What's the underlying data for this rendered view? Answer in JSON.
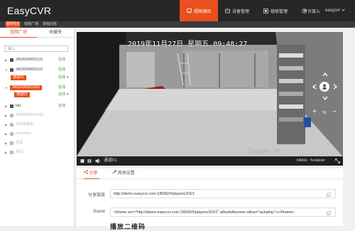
{
  "app": {
    "logo": "EasyCVR"
  },
  "nav": {
    "items": [
      {
        "label": "视频调阅",
        "icon": "monitor-icon",
        "active": true
      },
      {
        "label": "设备管理",
        "icon": "device-icon",
        "active": false
      },
      {
        "label": "级联管理",
        "icon": "cascade-icon",
        "active": false
      },
      {
        "label": "平台接入",
        "icon": "platform-icon",
        "active": false
      }
    ],
    "user": "easycvr"
  },
  "subnav": {
    "tabs": [
      {
        "label": "视频预览",
        "active": true
      },
      {
        "label": "视频广场",
        "active": false
      },
      {
        "label": "录像回看",
        "active": false
      }
    ]
  },
  "sidebar": {
    "tabs": [
      {
        "label": "视频广场",
        "active": true
      },
      {
        "label": "收藏夹",
        "active": false
      }
    ],
    "search_placeholder": "输入",
    "tree": [
      {
        "name": "34020000001110",
        "status": "在线",
        "dim": false,
        "star": false
      },
      {
        "name": "34020000001110",
        "status": "在线",
        "dim": false,
        "star": false
      },
      {
        "name": "通道01",
        "status": "在线",
        "dim": false,
        "star": true,
        "tag": true
      },
      {
        "name": "34020000001320",
        "status": "在线",
        "dim": false,
        "star": false,
        "tag": true
      },
      {
        "name": "通道01",
        "status": "在线",
        "dim": false,
        "star": true,
        "tag": true
      },
      {
        "name": "hk1",
        "status": "在线",
        "dim": false,
        "star": false
      },
      {
        "name": "34020000001320",
        "status": "",
        "dim": true,
        "star": false
      },
      {
        "name": "测试摄像机",
        "status": "",
        "dim": true,
        "star": false
      },
      {
        "name": "LiveVideo",
        "status": "",
        "dim": true,
        "star": false
      },
      {
        "name": "测试",
        "status": "",
        "dim": true,
        "star": false
      },
      {
        "name": "测试",
        "status": "",
        "dim": true,
        "star": false
      }
    ]
  },
  "video": {
    "osd_time": "2019年11月27日 星期五 09:48:27",
    "osd_camera": "Camera 01",
    "title": "通道01",
    "bitrate": "64kb/s",
    "brand": "Yunlanstx",
    "zoom": "50"
  },
  "panel": {
    "tabs": [
      {
        "label": "分享",
        "icon": "share-icon",
        "active": true
      },
      {
        "label": "其他设置",
        "icon": "wrench-icon",
        "active": false
      }
    ],
    "share_label": "分享链接",
    "share_url": "http://demo.easycvr.com:18000/#/players/3/3/1",
    "iframe_label": "iframe",
    "iframe_code": "<iframe src=\"http://demo.easycvr.com:18000/#/players/3/3/1\" allowfullscreen allow=\"autoplay\"></iframe>",
    "qr_label": "播放二维码"
  },
  "colors": {
    "accent": "#e9501d",
    "topbar": "#272727",
    "online": "#2a9d3a"
  }
}
